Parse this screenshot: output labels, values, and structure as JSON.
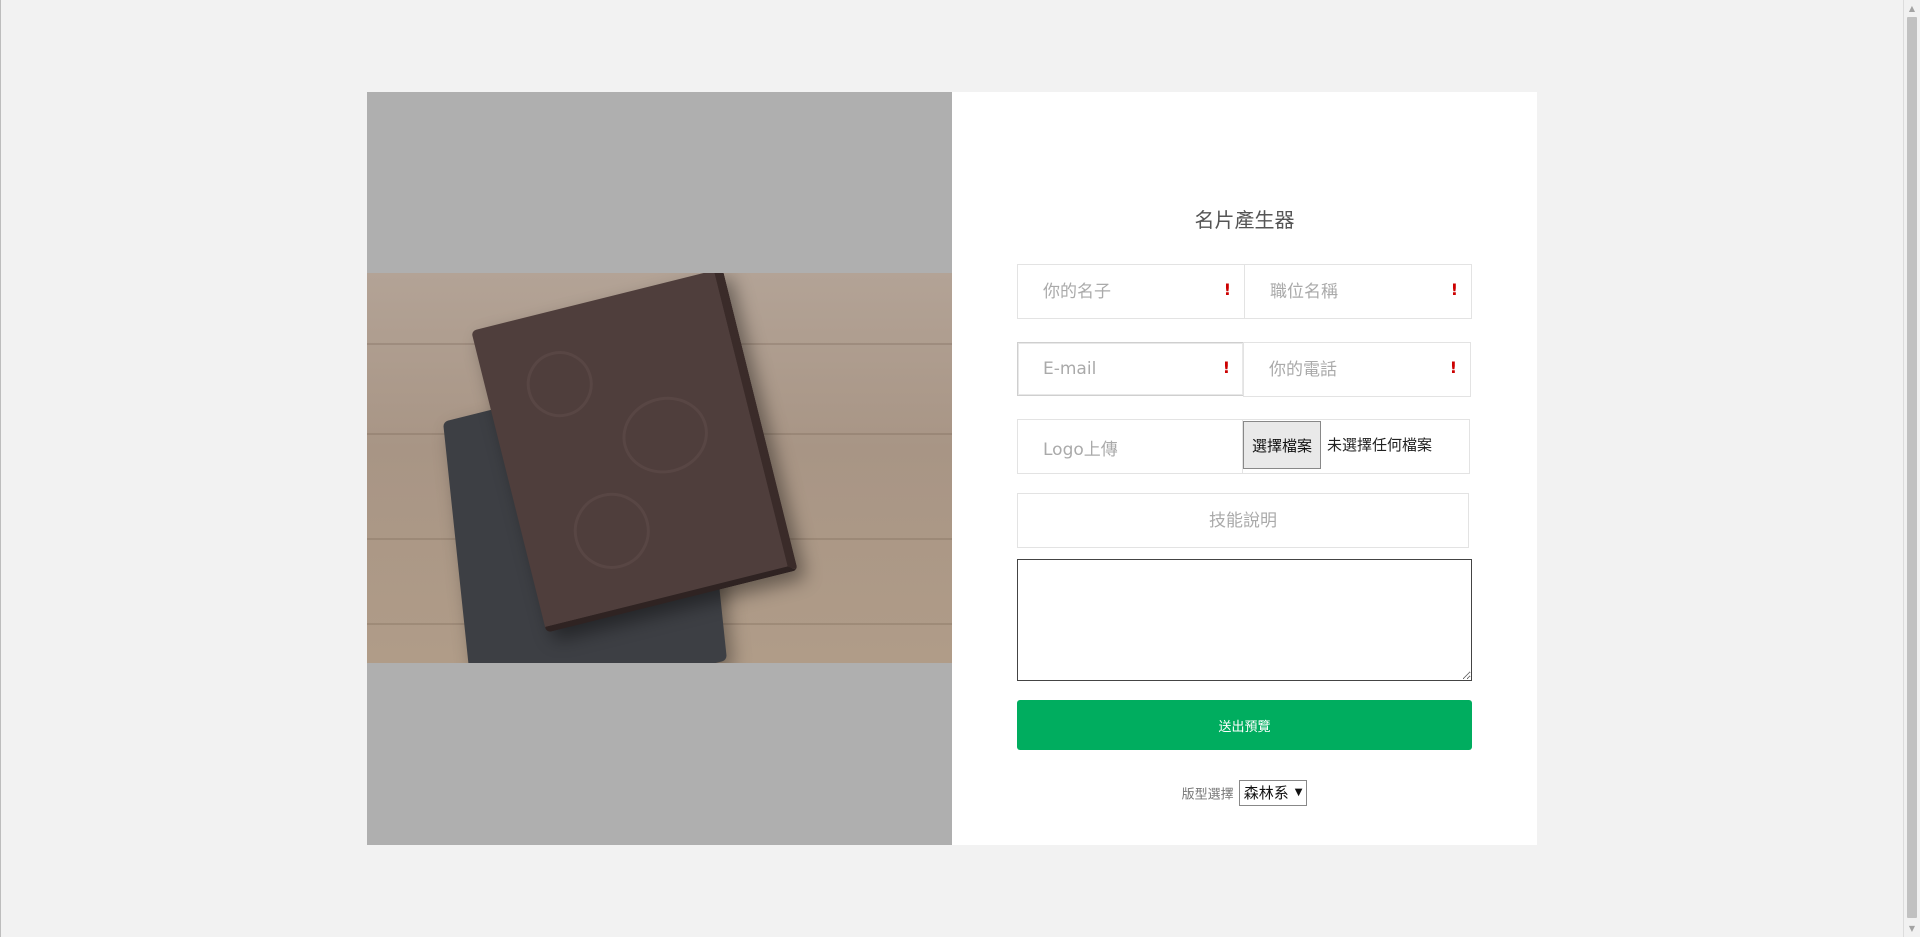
{
  "form": {
    "title": "名片產生器",
    "name_placeholder": "你的名子",
    "job_placeholder": "職位名稱",
    "email_placeholder": "E-mail",
    "phone_placeholder": "你的電話",
    "required_mark": "!",
    "logo_label": "Logo上傳",
    "file_button": "選擇檔案",
    "file_status": "未選擇任何檔案",
    "skill_placeholder": "技能說明",
    "skill_text": "",
    "submit": "送出預覽",
    "template_label": "版型選擇",
    "template_value": "森林系"
  },
  "icons": {
    "warn": "exclamation-icon",
    "caret": "caret-down-icon"
  },
  "colors": {
    "submit": "#00ad5f",
    "warn": "#cc0000",
    "background": "#f2f2f2",
    "image_bg": "#afafaf"
  }
}
